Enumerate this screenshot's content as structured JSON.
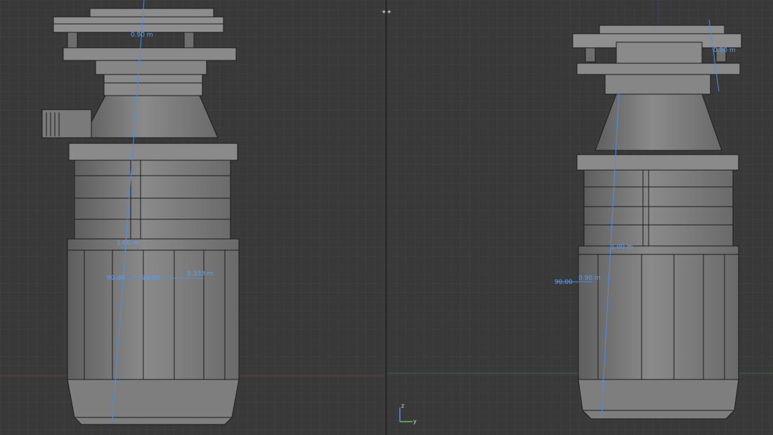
{
  "left_view": {
    "measurements": [
      "0.90 m",
      "1.00 m",
      "0.333 m",
      "90.00",
      "90.00"
    ]
  },
  "right_view": {
    "measurements": [
      "0.90 m",
      "1.00 m",
      "90.00",
      "0.90 m"
    ]
  },
  "axes": {
    "x": "y",
    "y": "z"
  },
  "colors": {
    "background": "#393939",
    "grid": "#434343",
    "mesh": "#7d7d7d",
    "wire": "#1c1c1c",
    "measure": "#4a90e2"
  }
}
